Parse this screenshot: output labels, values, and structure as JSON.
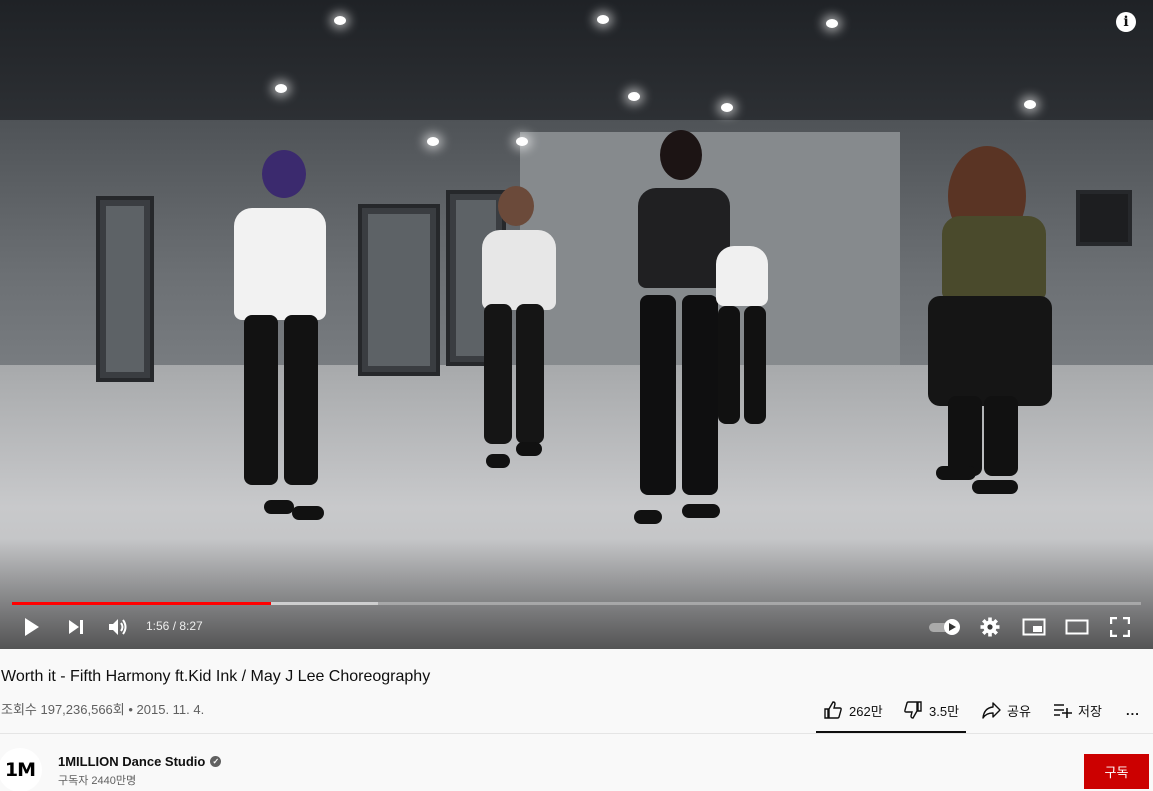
{
  "player": {
    "progress": {
      "current": "1:56",
      "duration": "8:27",
      "played_fraction": 0.229,
      "buffered_fraction": 0.324
    },
    "time_separator": " / ",
    "controls": [
      "play-icon",
      "next-icon",
      "volume-icon",
      "autoplay-toggle",
      "settings-icon",
      "miniplayer-icon",
      "theater-icon",
      "fullscreen-icon"
    ],
    "info_label": "i"
  },
  "video": {
    "title": "Worth it - Fifth Harmony ft.Kid Ink / May J Lee Choreography",
    "meta": "조회수 197,236,566회 • 2015. 11. 4."
  },
  "actions": {
    "like_count": "262만",
    "dislike_count": "3.5만",
    "share_label": "공유",
    "save_label": "저장",
    "more_label": "..."
  },
  "channel": {
    "avatar_text": "1M",
    "name": "1MILLION Dance Studio",
    "subscribers": "구독자 2440만명",
    "subscribe_label": "구독",
    "verified_mark": "✓"
  },
  "colors": {
    "accent": "#ff0000",
    "subscribe": "#cc0000",
    "meta_text": "#606060"
  }
}
